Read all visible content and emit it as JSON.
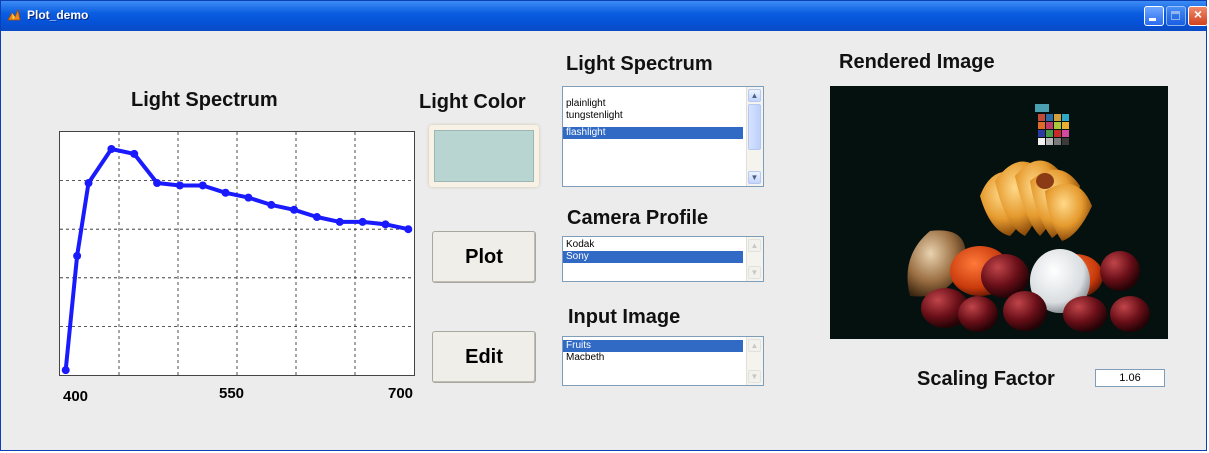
{
  "window": {
    "title": "Plot_demo",
    "close_glyph": "×"
  },
  "spectrum_plot": {
    "title": "Light Spectrum",
    "x_ticks": [
      "400",
      "550",
      "700"
    ],
    "line_color": "#1a1aff"
  },
  "chart_data": {
    "type": "line",
    "title": "Light Spectrum",
    "xlabel": "",
    "ylabel": "",
    "xlim": [
      395,
      705
    ],
    "x_ticks": [
      400,
      550,
      700
    ],
    "grid": true,
    "series": [
      {
        "x": [
          400,
          410,
          420,
          440,
          460,
          480,
          500,
          520,
          540,
          560,
          580,
          600,
          620,
          640,
          660,
          680,
          700
        ],
        "values": [
          0.02,
          0.49,
          0.79,
          0.93,
          0.91,
          0.79,
          0.78,
          0.78,
          0.75,
          0.73,
          0.7,
          0.68,
          0.65,
          0.63,
          0.63,
          0.62,
          0.6
        ]
      }
    ],
    "ylim": [
      0,
      1
    ]
  },
  "light_color": {
    "label": "Light Color",
    "swatch_color": "#b8d5d2"
  },
  "buttons": {
    "plot_label": "Plot",
    "edit_label": "Edit"
  },
  "light_spectrum_list": {
    "label": "Light Spectrum",
    "items": [
      "plainlight",
      "tungstenlight",
      "flashlight"
    ],
    "selected": "flashlight"
  },
  "camera_profile_list": {
    "label": "Camera Profile",
    "items": [
      "Kodak",
      "Sony"
    ],
    "selected": "Sony"
  },
  "input_image_list": {
    "label": "Input Image",
    "items": [
      "Fruits",
      "Macbeth"
    ],
    "selected": "Fruits"
  },
  "rendered_image": {
    "label": "Rendered Image"
  },
  "scaling": {
    "label": "Scaling Factor",
    "value": "1.06"
  },
  "scroll_glyphs": {
    "up": "▲",
    "down": "▼"
  }
}
